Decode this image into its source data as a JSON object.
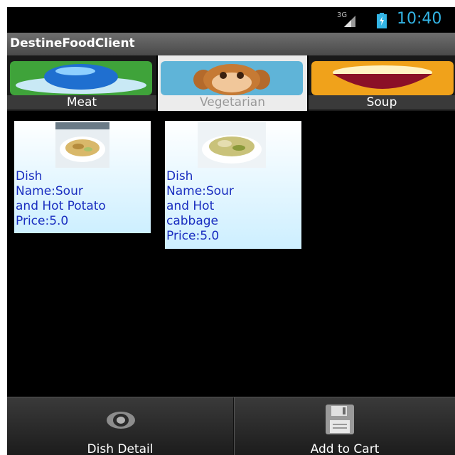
{
  "status_bar": {
    "network": "3G",
    "time": "10:40"
  },
  "app": {
    "title": "DestineFoodClient"
  },
  "tabs": [
    {
      "label": "Meat",
      "icon": "glass-dome-icon",
      "selected": false
    },
    {
      "label": "Vegetarian",
      "icon": "monkey-face-icon",
      "selected": true
    },
    {
      "label": "Soup",
      "icon": "soup-bowl-icon",
      "selected": false
    }
  ],
  "dishes": [
    {
      "name_line1": "Dish",
      "name_line2": "Name:Sour",
      "name_line3": "and Hot Potato",
      "price": "Price:5.0"
    },
    {
      "name_line1": "Dish",
      "name_line2": "Name:Sour",
      "name_line3": "and Hot",
      "name_line4": "cabbage",
      "price": "Price:5.0"
    }
  ],
  "bottom_actions": [
    {
      "label": "Dish Detail",
      "icon": "eye-icon"
    },
    {
      "label": "Add to Cart",
      "icon": "floppy-disk-icon"
    }
  ],
  "colors": {
    "clock": "#33b5e5",
    "dish_text": "#1a2ec0",
    "card_bg": "#cdefff"
  }
}
